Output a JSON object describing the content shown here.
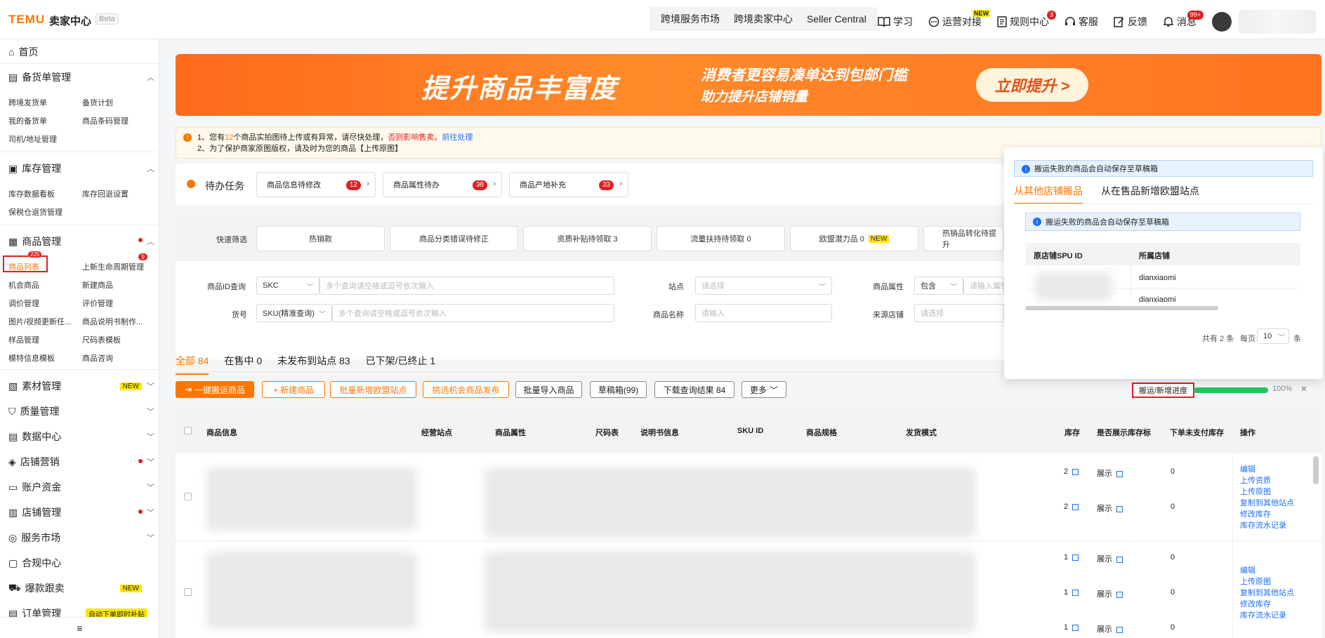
{
  "header": {
    "logo": "TEMU",
    "logo_sub": "卖家中心",
    "beta": "Beta",
    "links": [
      "跨境服务市场",
      "跨境卖家中心",
      "Seller Central"
    ],
    "tools": [
      {
        "label": "学习",
        "icon": "book-icon"
      },
      {
        "label": "运营对接",
        "icon": "chat-icon",
        "tag": "NEW"
      },
      {
        "label": "规则中心",
        "icon": "doc-icon",
        "badge": "3"
      },
      {
        "label": "客服",
        "icon": "headset-icon"
      },
      {
        "label": "反馈",
        "icon": "edit-icon"
      },
      {
        "label": "消息",
        "icon": "bell-icon",
        "badge": "99+"
      }
    ]
  },
  "sidebar": {
    "home": "首页",
    "stock_order": "备货单管理",
    "stock_order_subs": [
      "跨境发货单",
      "备货计划",
      "我的备货单",
      "商品条码管理",
      "司机/地址管理"
    ],
    "inventory": "库存管理",
    "inventory_subs": [
      "库存数据看板",
      "库存回退设置",
      "保税仓退货管理"
    ],
    "goods": "商品管理",
    "goods_subs": [
      "商品列表",
      "上新生命周期管理",
      "机会商品",
      "新建商品",
      "调价管理",
      "评价管理",
      "图片/视频更新任...",
      "商品说明书制作...",
      "样品管理",
      "尺码表模板",
      "模特信息模板",
      "商品咨询"
    ],
    "goods_badge": "9",
    "goods_list_badge": "225",
    "material": "素材管理",
    "material_tag": "NEW",
    "quality": "质量管理",
    "data": "数据中心",
    "marketing": "店铺营销",
    "account": "账户资金",
    "shop": "店铺管理",
    "service": "服务市场",
    "compliance": "合规中心",
    "hot": "爆款跟卖",
    "hot_tag": "NEW",
    "order": "订单管理",
    "order_tag": "自动下单即时补贴"
  },
  "banner": {
    "title": "提升商品丰富度",
    "line1": "消费者更容易凑单达到包邮门槛",
    "line2": "助力提升店铺销量",
    "cta": "立即提升 >"
  },
  "notice": {
    "line1_a": "1、您有",
    "line1_num": "12",
    "line1_b": "个商品实拍图待上传或有异常，请尽快处理，",
    "line1_red": "否则影响售卖。",
    "line1_link": "前往处理",
    "line2": "2、为了保护商家原图版权，请及时为您的商品【上传原图】"
  },
  "todo": {
    "label": "待办任务",
    "items": [
      {
        "label": "商品信息待修改",
        "count": "12"
      },
      {
        "label": "商品属性待办",
        "count": "38"
      },
      {
        "label": "商品产地补充",
        "count": "33"
      }
    ]
  },
  "quick": {
    "label": "快速筛选",
    "items": [
      "热销款",
      "商品分类错误待修正",
      "资质补贴待领取 3",
      "流量扶持待领取 0",
      "欧盟潜力品 0",
      "热销品转化待提升"
    ],
    "new_tag": "NEW"
  },
  "filters": {
    "id_label": "商品ID查询",
    "id_type": "SKC",
    "id_placeholder": "多个查询请空格或逗号依次输入",
    "site_label": "站点",
    "site_placeholder": "请选择",
    "attr_label": "商品属性",
    "attr_type": "包含",
    "attr_placeholder": "请输入属性",
    "sku_label": "货号",
    "sku_type": "SKU(精准查询)",
    "sku_placeholder": "多个查询请空格或逗号依次输入",
    "name_label": "商品名称",
    "name_placeholder": "请输入",
    "source_label": "来源店铺",
    "source_placeholder": "请选择"
  },
  "tabs": [
    {
      "label": "全部 84",
      "active": true
    },
    {
      "label": "在售中 0"
    },
    {
      "label": "未发布到站点 83"
    },
    {
      "label": "已下架/已终止 1"
    }
  ],
  "actions": [
    "一键搬运商品",
    "+ 新建商品",
    "批量新增欧盟站点",
    "挑选机会商品发布",
    "批量导入商品",
    "草稿箱(99)",
    "下载查询结果 84",
    "更多"
  ],
  "progress": {
    "label": "搬运/新增进度",
    "value": "100%",
    "fraction": 1.0
  },
  "table": {
    "headers": [
      "商品信息",
      "经营站点",
      "商品属性",
      "尺码表",
      "说明书信息",
      "SKU ID",
      "商品规格",
      "发货模式",
      "库存",
      "是否展示库存标",
      "下单未支付库存",
      "操作"
    ],
    "rows": [
      {
        "stock": "2",
        "show": "展示",
        "unpaid": "0"
      },
      {
        "stock": "2",
        "show": "展示",
        "unpaid": "0"
      },
      {
        "stock": "1",
        "show": "展示",
        "unpaid": "0"
      },
      {
        "stock": "1",
        "show": "展示",
        "unpaid": "0"
      },
      {
        "stock": "1",
        "show": "展示",
        "unpaid": "0"
      }
    ],
    "ops1": [
      "编辑",
      "上传资质",
      "上传原图",
      "复制到其他站点",
      "修改库存",
      "库存流水记录"
    ],
    "ops2": [
      "编辑",
      "上传原图",
      "复制到其他站点",
      "修改库存",
      "库存流水记录"
    ]
  },
  "popup": {
    "info": "搬运失败的商品会自动保存至草稿箱",
    "tabs": [
      "从其他店铺搬品",
      "从在售品新增欧盟站点"
    ],
    "info2": "搬运失败的商品会自动保存至草稿箱",
    "headers": [
      "原店铺SPU ID",
      "所属店铺"
    ],
    "rows": [
      "dianxiaomi",
      "dianxiaomi"
    ],
    "total": "共有 2 条",
    "per_page_label": "每页",
    "per_page": "10",
    "unit": "条"
  }
}
